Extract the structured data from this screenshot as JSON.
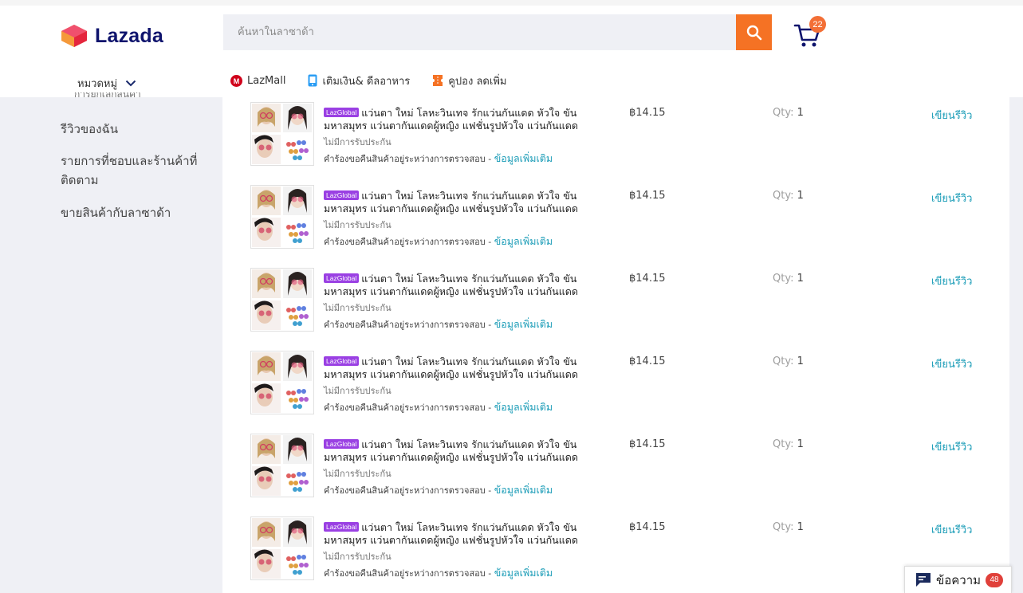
{
  "brand": {
    "name": "Lazada",
    "colors": {
      "navy": "#0f146d",
      "orange": "#f57224",
      "pink": "#f0506e",
      "red": "#e4253e",
      "accent_blue": "#1a9cb7",
      "lazglobal": "#9a40e3"
    }
  },
  "header": {
    "search_placeholder": "ค้นหาในลาซาด้า",
    "search_icon": "magnifier-icon",
    "cart_icon": "cart-icon",
    "cart_count": "22",
    "category_label": "หมวดหมู่",
    "subnav": [
      {
        "label": "LazMall",
        "icon": "lazmall-icon"
      },
      {
        "label": "เติมเงิน& ดีลอาหาร",
        "icon": "phone-topup-icon"
      },
      {
        "label": "คูปอง ลดเพิ่ม",
        "icon": "coupon-icon"
      }
    ]
  },
  "sidebar": {
    "clipped_item": "การยกเลิกสินค้า",
    "links": [
      "รีวิวของฉัน",
      "รายการที่ชอบและร้านค้าที่ติดตาม",
      "ขายสินค้ากับลาซาด้า"
    ]
  },
  "orders": {
    "items": [
      {
        "badge": "LazGlobal",
        "title": "แว่นตา ใหม่ โลหะวินเทจ รักแว่นกันแดด หัวใจ ขันมหาสมุทร แว่นตากันแดดผู้หญิง แฟชั่นรูปหัวใจ แว่นกันแดด",
        "warranty": "ไม่มีการรับประกัน",
        "status": "คำร้องขอคืนสินค้าอยู่ระหว่างการตรวจสอบ - ",
        "status_link": "ข้อมูลเพิ่มเติม",
        "price": "฿14.15",
        "qty_label": "Qty:",
        "qty": "1",
        "review": "เขียนรีวิว"
      },
      {
        "badge": "LazGlobal",
        "title": "แว่นตา ใหม่ โลหะวินเทจ รักแว่นกันแดด หัวใจ ขันมหาสมุทร แว่นตากันแดดผู้หญิง แฟชั่นรูปหัวใจ แว่นกันแดด",
        "warranty": "ไม่มีการรับประกัน",
        "status": "คำร้องขอคืนสินค้าอยู่ระหว่างการตรวจสอบ - ",
        "status_link": "ข้อมูลเพิ่มเติม",
        "price": "฿14.15",
        "qty_label": "Qty:",
        "qty": "1",
        "review": "เขียนรีวิว"
      },
      {
        "badge": "LazGlobal",
        "title": "แว่นตา ใหม่ โลหะวินเทจ รักแว่นกันแดด หัวใจ ขันมหาสมุทร แว่นตากันแดดผู้หญิง แฟชั่นรูปหัวใจ แว่นกันแดด",
        "warranty": "ไม่มีการรับประกัน",
        "status": "คำร้องขอคืนสินค้าอยู่ระหว่างการตรวจสอบ - ",
        "status_link": "ข้อมูลเพิ่มเติม",
        "price": "฿14.15",
        "qty_label": "Qty:",
        "qty": "1",
        "review": "เขียนรีวิว"
      },
      {
        "badge": "LazGlobal",
        "title": "แว่นตา ใหม่ โลหะวินเทจ รักแว่นกันแดด หัวใจ ขันมหาสมุทร แว่นตากันแดดผู้หญิง แฟชั่นรูปหัวใจ แว่นกันแดด",
        "warranty": "ไม่มีการรับประกัน",
        "status": "คำร้องขอคืนสินค้าอยู่ระหว่างการตรวจสอบ - ",
        "status_link": "ข้อมูลเพิ่มเติม",
        "price": "฿14.15",
        "qty_label": "Qty:",
        "qty": "1",
        "review": "เขียนรีวิว"
      },
      {
        "badge": "LazGlobal",
        "title": "แว่นตา ใหม่ โลหะวินเทจ รักแว่นกันแดด หัวใจ ขันมหาสมุทร แว่นตากันแดดผู้หญิง แฟชั่นรูปหัวใจ แว่นกันแดด",
        "warranty": "ไม่มีการรับประกัน",
        "status": "คำร้องขอคืนสินค้าอยู่ระหว่างการตรวจสอบ - ",
        "status_link": "ข้อมูลเพิ่มเติม",
        "price": "฿14.15",
        "qty_label": "Qty:",
        "qty": "1",
        "review": "เขียนรีวิว"
      },
      {
        "badge": "LazGlobal",
        "title": "แว่นตา ใหม่ โลหะวินเทจ รักแว่นกันแดด หัวใจ ขันมหาสมุทร แว่นตากันแดดผู้หญิง แฟชั่นรูปหัวใจ แว่นกันแดด",
        "warranty": "ไม่มีการรับประกัน",
        "status": "คำร้องขอคืนสินค้าอยู่ระหว่างการตรวจสอบ - ",
        "status_link": "ข้อมูลเพิ่มเติม",
        "price": "฿14.15",
        "qty_label": "Qty:",
        "qty": "1",
        "review": "เขียนรีวิว"
      }
    ]
  },
  "chat": {
    "label": "ข้อความ",
    "count": "48",
    "icon": "chat-bubble-icon"
  }
}
